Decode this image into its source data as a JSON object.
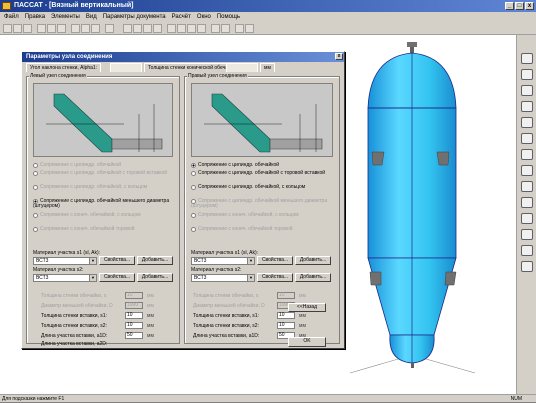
{
  "app": {
    "title": "ПАССАТ - [Вязный вертикальный]"
  },
  "menu": [
    "Файл",
    "Правка",
    "Элементы",
    "Вид",
    "Параметры документа",
    "Расчёт",
    "Окно",
    "Помощь"
  ],
  "dialog": {
    "title": "Параметры узла соединения",
    "close": "x",
    "tabs": [
      "Угол наклона стенки, Alpha1:",
      "",
      "Толщина стенки конической обечайки, s1:",
      "",
      "мм"
    ],
    "left": {
      "group_label": "Левый узел соединения",
      "radios": [
        "Сопряжение с цилиндр. обечайкой",
        "Сопряжение с цилиндр. обечайкой с торовой вставкой",
        "Сопряжение с цилиндр. обечайкой, с кольцом",
        "Сопряжение с цилиндр. обечайкой меньшего диаметра (штуцером)",
        "Сопряжение с конич. обечайкой, с кольцом",
        "Сопряжение с конич. обечайкой торовой"
      ],
      "material_s1_label": "Материал участка s1 (sl, Ak):",
      "material_s1": "ВСТ3",
      "material_s2_label": "Материал участка s2:",
      "material_s2": "ВСТ3",
      "props": "Свойства...",
      "add": "Добавить...",
      "fields": [
        {
          "label": "Толщина стенки обечайки, s",
          "value": "10",
          "unit": "мм"
        },
        {
          "label": "Диаметр меньшей обечайки, D",
          "value": "1000",
          "unit": "мм"
        },
        {
          "label": "Толщина стенки вставки, s1:",
          "value": "10",
          "unit": "мм"
        },
        {
          "label": "Толщина стенки вставки, s2:",
          "value": "10",
          "unit": "мм"
        },
        {
          "label": "Длина участка вставки, a1D:",
          "value": "50",
          "unit": "мм"
        },
        {
          "label": "Длина участка вставки, a2D:",
          "value": "50",
          "unit": "мм"
        }
      ]
    },
    "right": {
      "group_label": "Правый узел соединения",
      "radios": [
        "Сопряжение с цилиндр. обечайкой",
        "Сопряжение с цилиндр. обечайкой с торовой вставкой",
        "Сопряжение с цилиндр. обечайкой, с кольцом",
        "Сопряжение с цилиндр. обечайкой меньшего диаметра (штуцером)",
        "Сопряжение с конич. обечайкой, с кольцом",
        "Сопряжение с конич. обечайкой торовой"
      ],
      "material_s1_label": "Материал участка s1 (sl, Ak):",
      "material_s1": "ВСТ3",
      "material_s2_label": "Материал участка s2:",
      "material_s2": "ВСТ3",
      "props": "Свойства...",
      "add": "Добавить...",
      "fields": [
        {
          "label": "Толщина стенки обечайки, s",
          "value": "10",
          "unit": "мм"
        },
        {
          "label": "Диаметр меньшей обечайки, D",
          "value": "1000",
          "unit": "мм"
        },
        {
          "label": "Толщина стенки вставки, s1:",
          "value": "10",
          "unit": "мм"
        },
        {
          "label": "Толщина стенки вставки, s2:",
          "value": "10",
          "unit": "мм"
        },
        {
          "label": "Длина участка вставки, a1D:",
          "value": "50",
          "unit": "мм"
        },
        {
          "label": "Длина участка вставки, a2D:",
          "value": "50",
          "unit": "мм"
        }
      ]
    },
    "back_button": "<<Назад",
    "ok_button": "OK"
  },
  "status": {
    "left": "Для подсказки нажмите F1",
    "right": "NUM"
  },
  "colors": {
    "vessel": "#33c4f0",
    "vessel_edge": "#1a2a8a",
    "titlebar": "#1c3d8f",
    "nozzle": "#707070"
  }
}
